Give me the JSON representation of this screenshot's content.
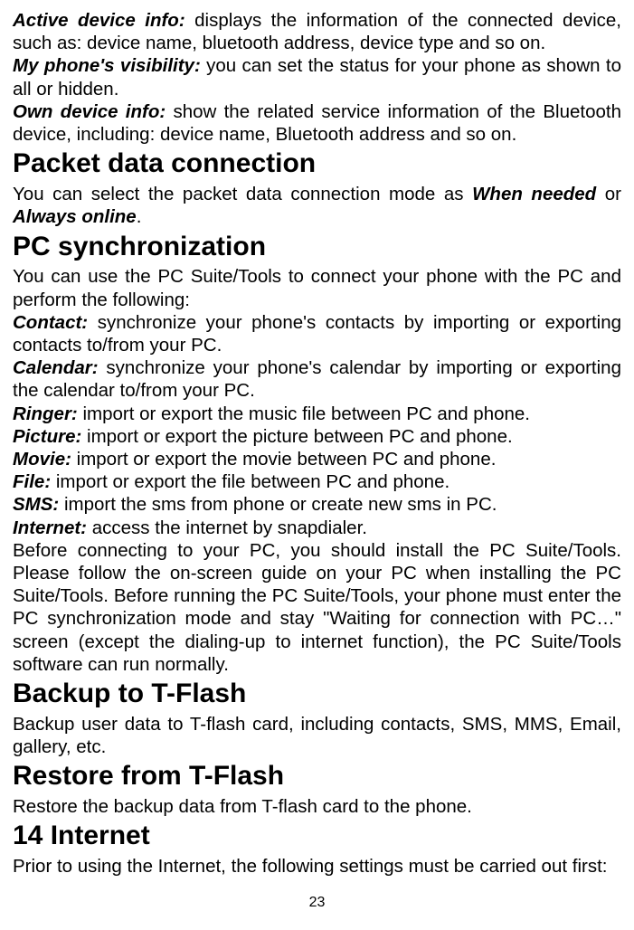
{
  "intro": {
    "activeDeviceLabel": "Active device info:",
    "activeDeviceText": " displays the information of the connected device, such as: device name, bluetooth address, device type and so on.",
    "visibilityLabel": "My phone's visibility:",
    "visibilityText": " you can set the status for your phone as shown to all or hidden.",
    "ownDeviceLabel": "Own device info:",
    "ownDeviceText": " show the related service information of the Bluetooth device, including: device name, Bluetooth address and so on."
  },
  "packetData": {
    "heading": "Packet data connection",
    "text1": "You can select the packet data connection mode as ",
    "whenNeeded": "When needed",
    "text2": " or ",
    "alwaysOnline": "Always online",
    "text3": "."
  },
  "pcSync": {
    "heading": "PC synchronization",
    "intro": "You can use the PC Suite/Tools to connect your phone with the PC and perform the following:",
    "contactLabel": "Contact:",
    "contactText": " synchronize your phone's contacts by importing or exporting contacts to/from your PC.",
    "calendarLabel": "Calendar:",
    "calendarText": " synchronize your phone's calendar by importing or exporting the calendar to/from your PC.",
    "ringerLabel": "Ringer:",
    "ringerText": " import or export the music file between PC and phone.",
    "pictureLabel": "Picture:",
    "pictureText": " import or export the picture between PC and phone.",
    "movieLabel": "Movie:",
    "movieText": " import or export the movie between PC and phone.",
    "fileLabel": "File:",
    "fileText": " import or export the file between PC and phone.",
    "smsLabel": "SMS:",
    "smsText": " import the sms from phone or create new sms in PC.",
    "internetLabel": "Internet:",
    "internetText": " access the internet by snapdialer.",
    "beforeConnecting": "Before connecting to your PC, you should install the PC Suite/Tools. Please follow the on-screen guide on your PC when installing the PC Suite/Tools. Before running the PC Suite/Tools, your phone must enter the PC synchronization mode and stay \"Waiting for connection with PC…\" screen (except the dialing-up to internet function), the PC Suite/Tools software can run normally."
  },
  "backup": {
    "heading": "Backup to T-Flash",
    "text": "Backup user data to T-flash card, including contacts, SMS, MMS, Email, gallery, etc."
  },
  "restore": {
    "heading": "Restore from T-Flash",
    "text": "Restore the backup data from T-flash card to the phone."
  },
  "internet": {
    "heading": "14 Internet",
    "text": "Prior to using the Internet, the following settings must be carried out first:"
  },
  "pageNumber": "23"
}
